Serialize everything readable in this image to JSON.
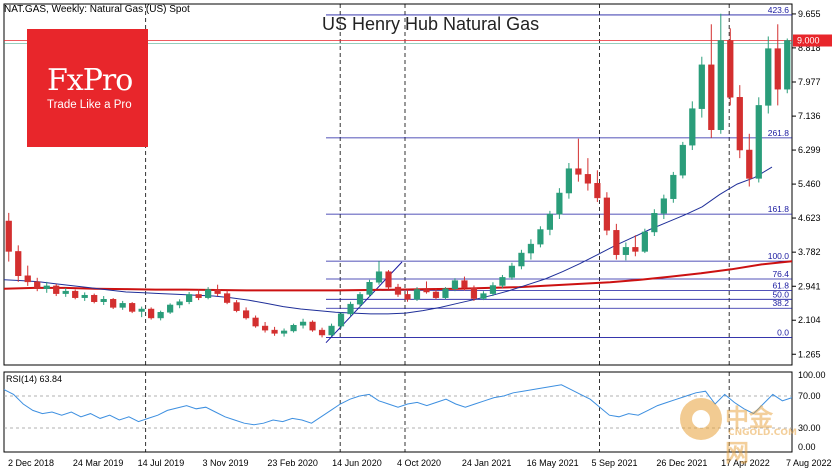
{
  "header": {
    "symbol_line": "NAT.GAS, Weekly:  Natural Gas (US) Spot",
    "title": "US Henry Hub Natural Gas"
  },
  "logo": {
    "brand": "FxPro",
    "tagline": "Trade Like a Pro"
  },
  "watermark": {
    "cn": "中金网",
    "en": "CNGOLD.COM"
  },
  "colors": {
    "bull": "#2a9d7a",
    "bear": "#d32f2f",
    "ma_short": "#1f2f99",
    "ma_long": "#cc1111",
    "fib": "#1a1aa0",
    "trend": "#1a1aa0",
    "rsi": "#3d8fe0",
    "price_tag_bg": "#e8262b"
  },
  "chart_data": [
    {
      "type": "candlestick",
      "title": "US Henry Hub Natural Gas",
      "timeframe": "Weekly",
      "x_tick_labels": [
        "2 Dec 2018",
        "24 Mar 2019",
        "14 Jul 2019",
        "3 Nov 2019",
        "23 Feb 2020",
        "14 Jun 2020",
        "4 Oct 2020",
        "24 Jan 2021",
        "16 May 2021",
        "5 Sep 2021",
        "26 Dec 2021",
        "17 Apr 2022",
        "7 Aug 2022"
      ],
      "y_tick_labels": [
        "9.655",
        "8.818",
        "7.977",
        "7.136",
        "6.299",
        "5.460",
        "4.623",
        "3.782",
        "2.941",
        "2.104",
        "1.265"
      ],
      "ylim": [
        1.0,
        9.9
      ],
      "current_price": "9.000",
      "vertical_separators": [
        "14 Jul 2019",
        "14 Jun 2020",
        "4 Oct 2020",
        "5 Sep 2021",
        "17 Apr 2022"
      ],
      "fibonacci": {
        "levels": [
          {
            "label": "0.0",
            "price": 1.68
          },
          {
            "label": "38.2",
            "price": 2.4
          },
          {
            "label": "50.0",
            "price": 2.62
          },
          {
            "label": "61.8",
            "price": 2.84
          },
          {
            "label": "76.4",
            "price": 3.12
          },
          {
            "label": "100.0",
            "price": 3.56
          },
          {
            "label": "161.8",
            "price": 4.72
          },
          {
            "label": "261.8",
            "price": 6.6
          },
          {
            "label": "423.6",
            "price": 9.63
          }
        ]
      },
      "trend_line": [
        [
          "2020-06",
          1.55
        ],
        [
          "2020-11",
          3.54
        ]
      ],
      "candles": [
        {
          "o": 4.55,
          "h": 4.75,
          "l": 3.55,
          "c": 3.8
        },
        {
          "o": 3.8,
          "h": 3.95,
          "l": 3.05,
          "c": 3.2
        },
        {
          "o": 3.2,
          "h": 3.45,
          "l": 2.95,
          "c": 3.05
        },
        {
          "o": 3.05,
          "h": 3.15,
          "l": 2.82,
          "c": 2.88
        },
        {
          "o": 2.88,
          "h": 3.05,
          "l": 2.78,
          "c": 2.95
        },
        {
          "o": 2.95,
          "h": 3.0,
          "l": 2.7,
          "c": 2.76
        },
        {
          "o": 2.76,
          "h": 2.9,
          "l": 2.68,
          "c": 2.82
        },
        {
          "o": 2.82,
          "h": 2.86,
          "l": 2.62,
          "c": 2.66
        },
        {
          "o": 2.66,
          "h": 2.79,
          "l": 2.58,
          "c": 2.72
        },
        {
          "o": 2.72,
          "h": 2.76,
          "l": 2.52,
          "c": 2.56
        },
        {
          "o": 2.56,
          "h": 2.7,
          "l": 2.48,
          "c": 2.62
        },
        {
          "o": 2.62,
          "h": 2.65,
          "l": 2.38,
          "c": 2.42
        },
        {
          "o": 2.42,
          "h": 2.58,
          "l": 2.36,
          "c": 2.52
        },
        {
          "o": 2.52,
          "h": 2.55,
          "l": 2.28,
          "c": 2.32
        },
        {
          "o": 2.32,
          "h": 2.44,
          "l": 2.18,
          "c": 2.38
        },
        {
          "o": 2.38,
          "h": 2.42,
          "l": 2.12,
          "c": 2.16
        },
        {
          "o": 2.16,
          "h": 2.34,
          "l": 2.1,
          "c": 2.3
        },
        {
          "o": 2.3,
          "h": 2.52,
          "l": 2.26,
          "c": 2.48
        },
        {
          "o": 2.48,
          "h": 2.62,
          "l": 2.4,
          "c": 2.56
        },
        {
          "o": 2.56,
          "h": 2.8,
          "l": 2.5,
          "c": 2.74
        },
        {
          "o": 2.74,
          "h": 2.86,
          "l": 2.6,
          "c": 2.66
        },
        {
          "o": 2.66,
          "h": 2.92,
          "l": 2.62,
          "c": 2.86
        },
        {
          "o": 2.86,
          "h": 2.98,
          "l": 2.7,
          "c": 2.76
        },
        {
          "o": 2.76,
          "h": 2.84,
          "l": 2.5,
          "c": 2.54
        },
        {
          "o": 2.54,
          "h": 2.6,
          "l": 2.3,
          "c": 2.34
        },
        {
          "o": 2.34,
          "h": 2.42,
          "l": 2.12,
          "c": 2.16
        },
        {
          "o": 2.16,
          "h": 2.22,
          "l": 1.92,
          "c": 1.96
        },
        {
          "o": 1.96,
          "h": 2.06,
          "l": 1.8,
          "c": 1.86
        },
        {
          "o": 1.86,
          "h": 1.94,
          "l": 1.72,
          "c": 1.78
        },
        {
          "o": 1.78,
          "h": 1.9,
          "l": 1.7,
          "c": 1.84
        },
        {
          "o": 1.84,
          "h": 2.02,
          "l": 1.8,
          "c": 1.98
        },
        {
          "o": 1.98,
          "h": 2.14,
          "l": 1.9,
          "c": 2.06
        },
        {
          "o": 2.06,
          "h": 2.1,
          "l": 1.82,
          "c": 1.86
        },
        {
          "o": 1.86,
          "h": 1.92,
          "l": 1.68,
          "c": 1.74
        },
        {
          "o": 1.74,
          "h": 2.02,
          "l": 1.7,
          "c": 1.96
        },
        {
          "o": 1.96,
          "h": 2.3,
          "l": 1.9,
          "c": 2.26
        },
        {
          "o": 2.26,
          "h": 2.56,
          "l": 2.2,
          "c": 2.5
        },
        {
          "o": 2.5,
          "h": 2.8,
          "l": 2.42,
          "c": 2.74
        },
        {
          "o": 2.74,
          "h": 3.1,
          "l": 2.68,
          "c": 3.04
        },
        {
          "o": 3.04,
          "h": 3.56,
          "l": 2.98,
          "c": 3.3
        },
        {
          "o": 3.3,
          "h": 3.34,
          "l": 2.86,
          "c": 2.92
        },
        {
          "o": 2.92,
          "h": 3.0,
          "l": 2.68,
          "c": 2.74
        },
        {
          "o": 2.74,
          "h": 2.86,
          "l": 2.56,
          "c": 2.62
        },
        {
          "o": 2.62,
          "h": 2.92,
          "l": 2.58,
          "c": 2.86
        },
        {
          "o": 2.86,
          "h": 3.06,
          "l": 2.76,
          "c": 2.8
        },
        {
          "o": 2.8,
          "h": 2.88,
          "l": 2.62,
          "c": 2.66
        },
        {
          "o": 2.66,
          "h": 2.92,
          "l": 2.62,
          "c": 2.88
        },
        {
          "o": 2.88,
          "h": 3.14,
          "l": 2.82,
          "c": 3.08
        },
        {
          "o": 3.08,
          "h": 3.18,
          "l": 2.84,
          "c": 2.9
        },
        {
          "o": 2.9,
          "h": 2.96,
          "l": 2.58,
          "c": 2.64
        },
        {
          "o": 2.64,
          "h": 2.82,
          "l": 2.6,
          "c": 2.76
        },
        {
          "o": 2.76,
          "h": 3.04,
          "l": 2.7,
          "c": 2.96
        },
        {
          "o": 2.96,
          "h": 3.22,
          "l": 2.9,
          "c": 3.16
        },
        {
          "o": 3.16,
          "h": 3.52,
          "l": 3.1,
          "c": 3.44
        },
        {
          "o": 3.44,
          "h": 3.84,
          "l": 3.36,
          "c": 3.76
        },
        {
          "o": 3.76,
          "h": 4.1,
          "l": 3.6,
          "c": 3.98
        },
        {
          "o": 3.98,
          "h": 4.42,
          "l": 3.9,
          "c": 4.34
        },
        {
          "o": 4.34,
          "h": 4.8,
          "l": 4.2,
          "c": 4.72
        },
        {
          "o": 4.72,
          "h": 5.36,
          "l": 4.6,
          "c": 5.24
        },
        {
          "o": 5.24,
          "h": 5.98,
          "l": 5.1,
          "c": 5.84
        },
        {
          "o": 5.84,
          "h": 6.58,
          "l": 5.52,
          "c": 5.7
        },
        {
          "o": 5.7,
          "h": 6.1,
          "l": 5.3,
          "c": 5.48
        },
        {
          "o": 5.48,
          "h": 5.8,
          "l": 5.02,
          "c": 5.12
        },
        {
          "o": 5.12,
          "h": 5.26,
          "l": 4.2,
          "c": 4.32
        },
        {
          "o": 4.32,
          "h": 4.48,
          "l": 3.6,
          "c": 3.72
        },
        {
          "o": 3.72,
          "h": 4.02,
          "l": 3.58,
          "c": 3.9
        },
        {
          "o": 3.9,
          "h": 4.2,
          "l": 3.68,
          "c": 3.8
        },
        {
          "o": 3.8,
          "h": 4.36,
          "l": 3.76,
          "c": 4.28
        },
        {
          "o": 4.28,
          "h": 4.84,
          "l": 4.18,
          "c": 4.74
        },
        {
          "o": 4.74,
          "h": 5.2,
          "l": 4.6,
          "c": 5.1
        },
        {
          "o": 5.1,
          "h": 5.76,
          "l": 5.0,
          "c": 5.68
        },
        {
          "o": 5.68,
          "h": 6.5,
          "l": 5.6,
          "c": 6.42
        },
        {
          "o": 6.42,
          "h": 7.5,
          "l": 6.3,
          "c": 7.32
        },
        {
          "o": 7.32,
          "h": 8.6,
          "l": 7.1,
          "c": 8.4
        },
        {
          "o": 8.4,
          "h": 9.4,
          "l": 6.6,
          "c": 6.8
        },
        {
          "o": 6.8,
          "h": 9.66,
          "l": 6.7,
          "c": 9.0
        },
        {
          "o": 9.0,
          "h": 9.3,
          "l": 7.4,
          "c": 7.6
        },
        {
          "o": 7.6,
          "h": 7.9,
          "l": 6.1,
          "c": 6.3
        },
        {
          "o": 6.3,
          "h": 6.7,
          "l": 5.4,
          "c": 5.6
        },
        {
          "o": 5.6,
          "h": 7.6,
          "l": 5.5,
          "c": 7.4
        },
        {
          "o": 7.4,
          "h": 9.1,
          "l": 7.2,
          "c": 8.8
        },
        {
          "o": 8.8,
          "h": 9.4,
          "l": 7.4,
          "c": 7.8
        },
        {
          "o": 7.8,
          "h": 9.05,
          "l": 7.7,
          "c": 9.0
        }
      ],
      "ma_short": [
        3.1,
        3.08,
        3.05,
        3.0,
        2.95,
        2.9,
        2.85,
        2.8,
        2.78,
        2.76,
        2.74,
        2.72,
        2.7,
        2.66,
        2.6,
        2.52,
        2.44,
        2.38,
        2.34,
        2.3,
        2.28,
        2.26,
        2.26,
        2.28,
        2.34,
        2.42,
        2.52,
        2.62,
        2.72,
        2.84,
        2.98,
        3.12,
        3.3,
        3.5,
        3.72,
        3.94,
        4.14,
        4.34,
        4.52,
        4.7,
        4.9,
        5.2,
        5.46,
        5.62,
        5.88
      ],
      "ma_long": [
        2.88,
        2.9,
        2.9,
        2.88,
        2.87,
        2.86,
        2.86,
        2.85,
        2.84,
        2.84,
        2.84,
        2.84,
        2.85,
        2.86,
        2.87,
        2.88,
        2.9,
        2.92,
        2.96,
        3.0,
        3.04,
        3.1,
        3.18,
        3.26,
        3.36,
        3.48,
        3.56
      ],
      "rsi": {
        "label": "RSI(14) 63.84",
        "levels": [
          {
            "label": "100.00",
            "value": 100
          },
          {
            "label": "70.00",
            "value": 70
          },
          {
            "label": "30.00",
            "value": 30
          },
          {
            "label": "0.00",
            "value": 0
          }
        ],
        "values": [
          78,
          72,
          60,
          52,
          48,
          50,
          46,
          50,
          44,
          48,
          42,
          46,
          40,
          44,
          38,
          42,
          46,
          52,
          55,
          58,
          54,
          56,
          50,
          44,
          40,
          36,
          34,
          36,
          40,
          38,
          42,
          40,
          36,
          44,
          52,
          60,
          66,
          70,
          72,
          64,
          60,
          56,
          60,
          62,
          58,
          62,
          66,
          60,
          56,
          60,
          64,
          68,
          70,
          74,
          76,
          78,
          80,
          82,
          84,
          78,
          72,
          66,
          56,
          46,
          44,
          48,
          46,
          52,
          58,
          62,
          66,
          70,
          74,
          76,
          60,
          72,
          62,
          54,
          48,
          60,
          72,
          64,
          68
        ]
      }
    }
  ]
}
